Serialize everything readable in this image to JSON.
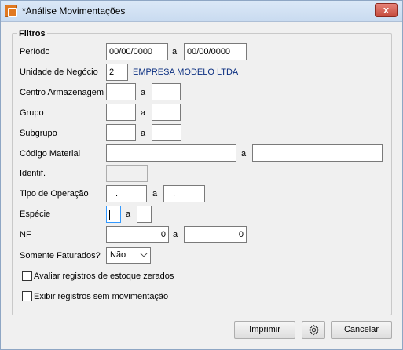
{
  "window": {
    "title": "*Análise Movimentações",
    "close_label": "x"
  },
  "filters": {
    "group_label": "Filtros",
    "separator": "a",
    "periodo": {
      "label": "Período",
      "from": "00/00/0000",
      "to": "00/00/0000"
    },
    "unidade": {
      "label": "Unidade de Negócio",
      "code": "2",
      "name": "EMPRESA MODELO LTDA"
    },
    "centro": {
      "label": "Centro Armazenagem",
      "from": "",
      "to": ""
    },
    "grupo": {
      "label": "Grupo",
      "from": "",
      "to": ""
    },
    "subgrupo": {
      "label": "Subgrupo",
      "from": "",
      "to": ""
    },
    "codigo_material": {
      "label": "Código Material",
      "from": "",
      "to": ""
    },
    "identif": {
      "label": "Identif.",
      "value": ""
    },
    "tipo_operacao": {
      "label": "Tipo de Operação",
      "from": ".",
      "to": "."
    },
    "especie": {
      "label": "Espécie",
      "from": "",
      "to": ""
    },
    "nf": {
      "label": "NF",
      "from": "0",
      "to": "0"
    },
    "somente_faturados": {
      "label": "Somente Faturados?",
      "value": "Não"
    },
    "avaliar_zerados": {
      "label": "Avaliar registros de estoque zerados",
      "checked": false
    },
    "exibir_sem_mov": {
      "label": "Exibir registros sem movimentação",
      "checked": false
    }
  },
  "footer": {
    "print_label": "Imprimir",
    "settings_icon": "gear-icon",
    "cancel_label": "Cancelar"
  }
}
